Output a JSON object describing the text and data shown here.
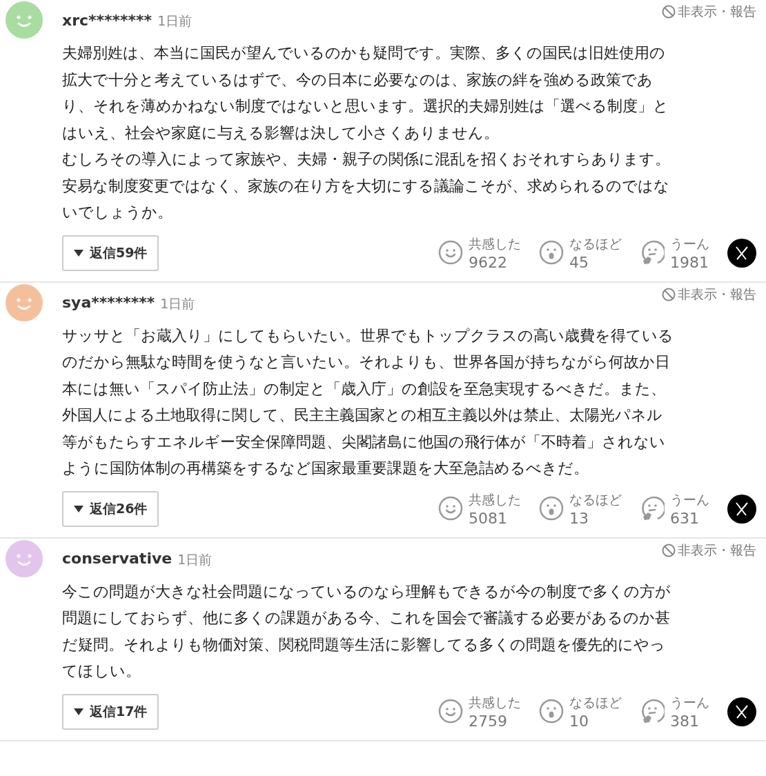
{
  "comments": [
    {
      "user": "xrc********",
      "time": "1日前",
      "color": "#a8dca0",
      "hide_report": "非表示・報告",
      "lines": [
        "夫婦別姓は、本当に国民が望んでいるのかも疑問です。実際、多くの国民は旧姓使用の",
        "拡大で十分と考えているはずで、今の日本に必要なのは、家族の絆を強める政策であ",
        "り、それを薄めかねない制度ではないと思います。選択的夫婦別姓は「選べる制度」と",
        "はいえ、社会や家庭に与える影響は決して小さくありません。",
        "むしろその導入によって家族や、夫婦・親子の関係に混乱を招くおそれすらあります。",
        "安易な制度変更ではなく、家族の在り方を大切にする議論こそが、求められるのではな",
        "いでしょうか。"
      ],
      "replies": "返信59件",
      "reactions": [
        {
          "kind": "smile",
          "label": "共感した",
          "count": "9622"
        },
        {
          "kind": "wow",
          "label": "なるほど",
          "count": "45"
        },
        {
          "kind": "think",
          "label": "うーん",
          "count": "1981"
        }
      ]
    },
    {
      "user": "sya********",
      "time": "1日前",
      "color": "#f4c09c",
      "hide_report": "非表示・報告",
      "lines": [
        "サッサと「お蔵入り」にしてもらいたい。世界でもトップクラスの高い歳費を得ている",
        "のだから無駄な時間を使うなと言いたい。それよりも、世界各国が持ちながら何故か日",
        "本には無い「スパイ防止法」の制定と「歳入庁」の創設を至急実現するべきだ。また、",
        "外国人による土地取得に関して、民主主義国家との相互主義以外は禁止、太陽光パネル",
        "等がもたらすエネルギー安全保障問題、尖閣諸島に他国の飛行体が「不時着」されない",
        "ように国防体制の再構築をするなど国家最重要課題を大至急詰めるべきだ。"
      ],
      "replies": "返信26件",
      "reactions": [
        {
          "kind": "smile",
          "label": "共感した",
          "count": "5081"
        },
        {
          "kind": "wow",
          "label": "なるほど",
          "count": "13"
        },
        {
          "kind": "think",
          "label": "うーん",
          "count": "631"
        }
      ]
    },
    {
      "user": "conservative",
      "time": "1日前",
      "color": "#e2c4ec",
      "hide_report": "非表示・報告",
      "lines": [
        "今この問題が大きな社会問題になっているのなら理解もできるが今の制度で多くの方が",
        "問題にしておらず、他に多くの課題がある今、これを国会で審議する必要があるのか甚",
        "だ疑問。それよりも物価対策、関税問題等生活に影響してる多くの問題を優先的にやっ",
        "てほしい。"
      ],
      "replies": "返信17件",
      "reactions": [
        {
          "kind": "smile",
          "label": "共感した",
          "count": "2759"
        },
        {
          "kind": "wow",
          "label": "なるほど",
          "count": "10"
        },
        {
          "kind": "think",
          "label": "うーん",
          "count": "381"
        }
      ]
    }
  ]
}
